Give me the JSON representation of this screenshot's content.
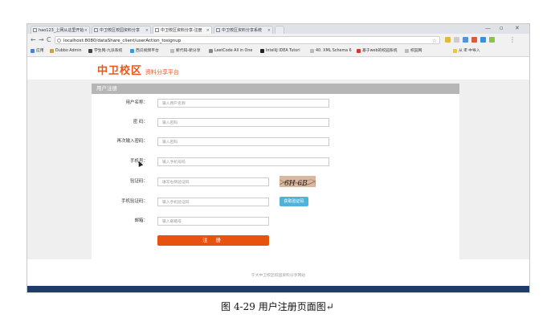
{
  "browser": {
    "tabs": [
      {
        "label": "hao123_上网从这里开始"
      },
      {
        "label": "中卫校区校园资料分享"
      },
      {
        "label": "中卫校区资料分享-注册"
      },
      {
        "label": "中卫校区资料分享系统"
      }
    ],
    "url": "localhost:8080/dataShare_client/userAction_tosignup",
    "window_controls": {
      "minimize": "—",
      "maximize": "▫",
      "close": "✕"
    },
    "nav": {
      "back": "←",
      "forward": "→",
      "reload": "C"
    },
    "bookmarks": [
      {
        "label": "应用"
      },
      {
        "label": "Dubbo Admin"
      },
      {
        "label": "学生网-九派系统"
      },
      {
        "label": "西瓜视频平台"
      },
      {
        "label": "新代码-新分享"
      },
      {
        "label": "LeetCode All in One"
      },
      {
        "label": "IntelliJ IDEA Tutori"
      },
      {
        "label": "40. XML Schema 6"
      },
      {
        "label": "基于web的校园系统"
      },
      {
        "label": "校园网"
      },
      {
        "label": "从 IE 中导入"
      }
    ]
  },
  "site": {
    "logo_main": "中卫校区",
    "logo_sub": "资料分享平台"
  },
  "form": {
    "panel_title": "用户注册",
    "fields": [
      {
        "label": "用户名称：",
        "placeholder": "输入用户名称"
      },
      {
        "label": "密  码：",
        "placeholder": "输入密码"
      },
      {
        "label": "再次输入密码：",
        "placeholder": "输入密码"
      },
      {
        "label": "手机号：",
        "placeholder": "输入手机号码"
      },
      {
        "label": "验证码：",
        "placeholder": "填写右侧验证码"
      },
      {
        "label": "手机验证码：",
        "placeholder": "输入手机验证码"
      },
      {
        "label": "邮箱：",
        "placeholder": "输入邮箱号"
      }
    ],
    "captcha_text": "6H 6B",
    "get_code_button": "获取验证码",
    "register_button": "注  册"
  },
  "footer": "宁大中卫校区校园资料分享网站",
  "caption": "图 4-29  用户注册页面图↵",
  "colors": {
    "brand": "#e8551a",
    "button": "#e8520f",
    "getcode": "#4fb3d9",
    "panel_header": "#b6b6b6"
  }
}
